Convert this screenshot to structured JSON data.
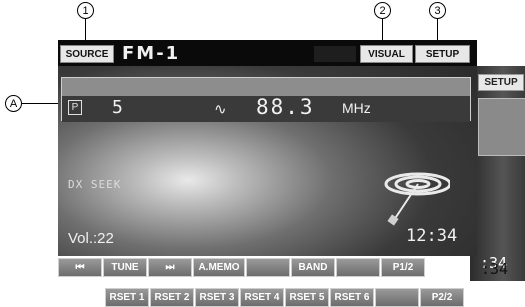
{
  "callouts": [
    "1",
    "2",
    "3",
    "A"
  ],
  "header": {
    "source_label": "SOURCE",
    "band_title": "FM-1",
    "visual_label": "VISUAL",
    "setup_label": "SETUP"
  },
  "tuner": {
    "pty_badge": "P",
    "preset_number": "5",
    "frequency": "88.3",
    "unit": "MHz",
    "seek_mode": "DX SEEK",
    "volume": "Vol.:22",
    "clock": "12:34"
  },
  "back_screen": {
    "setup_label": "SETUP",
    "clock_partial": ":34",
    "page_label": "P2/2"
  },
  "buttons_page1": [
    "⏮",
    "TUNE",
    "⏭",
    "A.MEMO",
    "",
    "BAND",
    "",
    "P1/2"
  ],
  "buttons_page2": [
    "RSET 1",
    "RSET 2",
    "RSET 3",
    "RSET 4",
    "RSET 5",
    "RSET 6",
    "",
    "P2/2"
  ],
  "icons": {
    "prev": "skip-back-icon",
    "next": "skip-forward-icon",
    "tune": "tune-wave-icon",
    "antenna": "antenna-signal-icon"
  }
}
